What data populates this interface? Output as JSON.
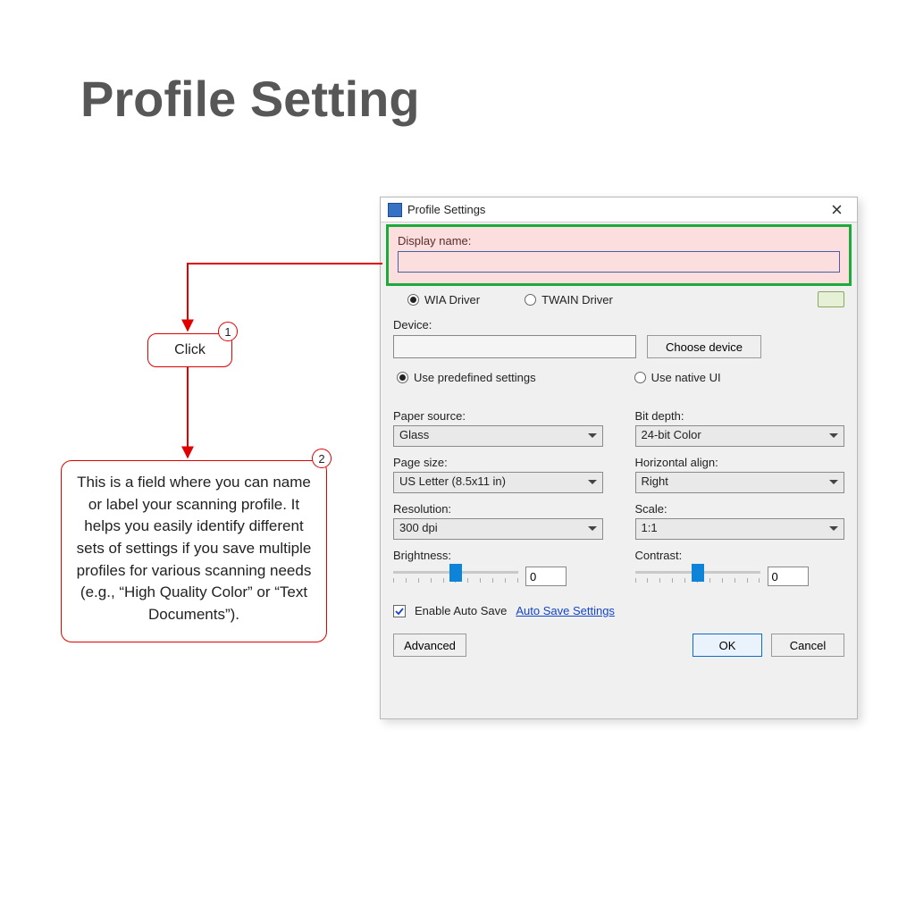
{
  "page": {
    "heading": "Profile Setting"
  },
  "anno": {
    "step1": {
      "num": "1",
      "label": "Click"
    },
    "step2": {
      "num": "2",
      "text": "This is a field where you can name or label your scanning profile. It helps you easily identify different sets of settings if you save multiple profiles for various scanning needs (e.g., “High Quality Color” or “Text Documents”)."
    }
  },
  "dialog": {
    "title": "Profile Settings",
    "displayName": {
      "label": "Display name:",
      "value": ""
    },
    "drivers": {
      "wia": "WIA Driver",
      "twain": "TWAIN Driver",
      "selected": "wia"
    },
    "device": {
      "label": "Device:",
      "value": "",
      "choose": "Choose device"
    },
    "settingsMode": {
      "predef": "Use predefined settings",
      "native": "Use native UI",
      "selected": "predef"
    },
    "left": {
      "paperSource": {
        "label": "Paper source:",
        "value": "Glass"
      },
      "pageSize": {
        "label": "Page size:",
        "value": "US Letter (8.5x11 in)"
      },
      "resolution": {
        "label": "Resolution:",
        "value": "300 dpi"
      },
      "brightness": {
        "label": "Brightness:",
        "value": "0"
      }
    },
    "right": {
      "bitDepth": {
        "label": "Bit depth:",
        "value": "24-bit Color"
      },
      "halign": {
        "label": "Horizontal align:",
        "value": "Right"
      },
      "scale": {
        "label": "Scale:",
        "value": "1:1"
      },
      "contrast": {
        "label": "Contrast:",
        "value": "0"
      }
    },
    "autoSave": {
      "enabled": true,
      "label": "Enable Auto Save",
      "link": "Auto Save Settings"
    },
    "buttons": {
      "advanced": "Advanced",
      "ok": "OK",
      "cancel": "Cancel"
    }
  }
}
